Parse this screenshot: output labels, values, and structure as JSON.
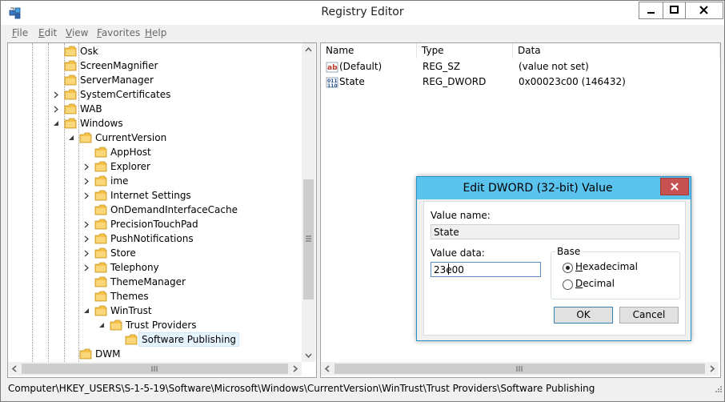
{
  "window": {
    "title": "Registry Editor"
  },
  "menu": [
    {
      "label": "File",
      "underline": "F",
      "rest": "ile"
    },
    {
      "label": "Edit",
      "underline": "E",
      "rest": "dit"
    },
    {
      "label": "View",
      "underline": "V",
      "rest": "iew"
    },
    {
      "label": "Favorites",
      "underline": "F",
      "rest": "avorites"
    },
    {
      "label": "Help",
      "underline": "H",
      "rest": "elp"
    }
  ],
  "tree": {
    "items": [
      {
        "label": "Osk",
        "expander": "none"
      },
      {
        "label": "ScreenMagnifier",
        "expander": "none"
      },
      {
        "label": "ServerManager",
        "expander": "none"
      },
      {
        "label": "SystemCertificates",
        "expander": "collapsed"
      },
      {
        "label": "WAB",
        "expander": "collapsed"
      },
      {
        "label": "Windows",
        "expander": "expanded"
      },
      {
        "label": "CurrentVersion",
        "expander": "expanded"
      },
      {
        "label": "AppHost",
        "expander": "none"
      },
      {
        "label": "Explorer",
        "expander": "collapsed"
      },
      {
        "label": "ime",
        "expander": "collapsed"
      },
      {
        "label": "Internet Settings",
        "expander": "collapsed"
      },
      {
        "label": "OnDemandInterfaceCache",
        "expander": "none"
      },
      {
        "label": "PrecisionTouchPad",
        "expander": "collapsed"
      },
      {
        "label": "PushNotifications",
        "expander": "collapsed"
      },
      {
        "label": "Store",
        "expander": "collapsed"
      },
      {
        "label": "Telephony",
        "expander": "collapsed"
      },
      {
        "label": "ThemeManager",
        "expander": "none"
      },
      {
        "label": "Themes",
        "expander": "none"
      },
      {
        "label": "WinTrust",
        "expander": "expanded"
      },
      {
        "label": "Trust Providers",
        "expander": "expanded"
      },
      {
        "label": "Software Publishing",
        "expander": "none",
        "selected": true
      },
      {
        "label": "DWM",
        "expander": "none"
      }
    ]
  },
  "list": {
    "columns": [
      "Name",
      "Type",
      "Data"
    ],
    "rows": [
      {
        "name": "(Default)",
        "type": "REG_SZ",
        "data": "(value not set)",
        "icon": "string-value-icon"
      },
      {
        "name": "State",
        "type": "REG_DWORD",
        "data": "0x00023c00 (146432)",
        "icon": "binary-value-icon"
      }
    ]
  },
  "status": {
    "path": "Computer\\HKEY_USERS\\S-1-5-19\\Software\\Microsoft\\Windows\\CurrentVersion\\WinTrust\\Trust Providers\\Software Publishing"
  },
  "dialog": {
    "title": "Edit DWORD (32-bit) Value",
    "value_name_label": "Value name:",
    "value_name": "State",
    "value_data_label": "Value data:",
    "value_data": "23e00",
    "base_label": "Base",
    "hex_label": "Hexadecimal",
    "dec_label": "Decimal",
    "base_selected": "Hexadecimal",
    "ok_label": "OK",
    "cancel_label": "Cancel"
  },
  "colors": {
    "dialog_title": "#5ac4ef",
    "close": "#c75050",
    "selection": "#e5f3fb",
    "folder": "#f4c24b"
  }
}
